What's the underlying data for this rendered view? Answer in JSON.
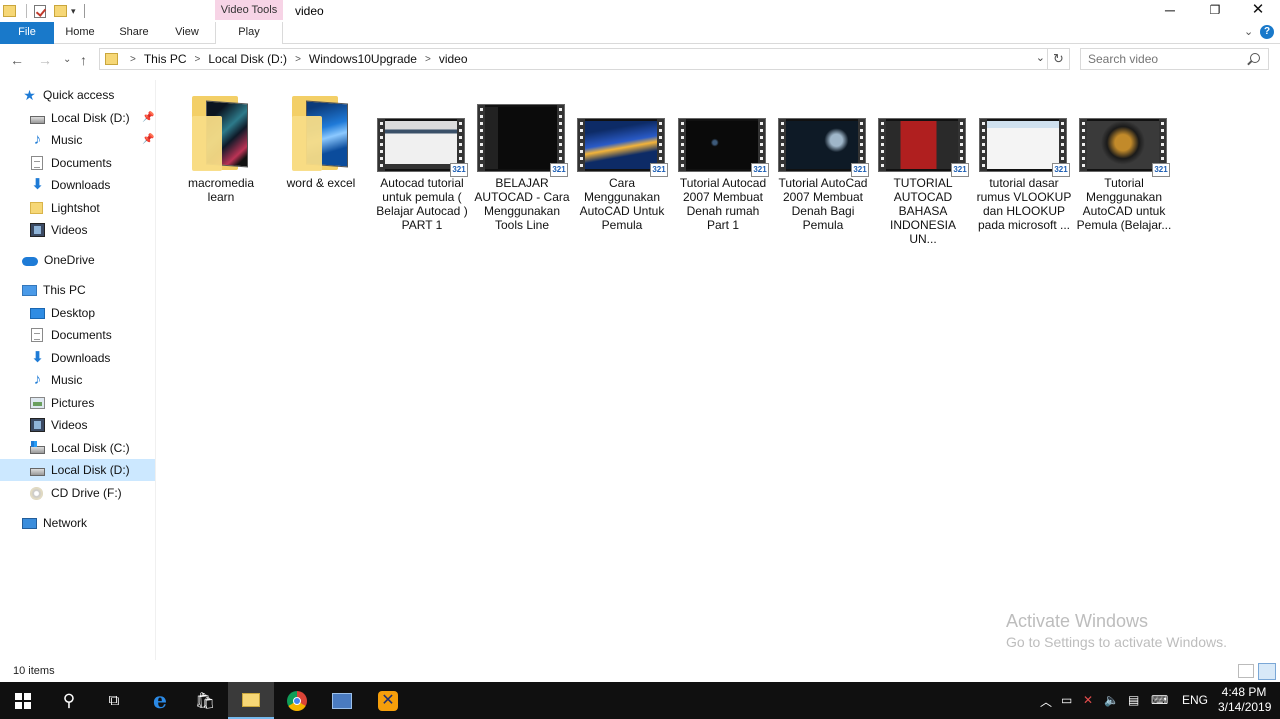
{
  "window": {
    "title": "video",
    "contextual_tab": "Video Tools"
  },
  "ribbon": {
    "tabs": [
      "File",
      "Home",
      "Share",
      "View",
      "Play"
    ]
  },
  "address": {
    "crumbs": [
      "This PC",
      "Local Disk (D:)",
      "Windows10Upgrade",
      "video"
    ]
  },
  "search": {
    "placeholder": "Search video"
  },
  "nav": {
    "quick_access": {
      "label": "Quick access",
      "items": [
        "Local Disk (D:)",
        "Music",
        "Documents",
        "Downloads",
        "Lightshot",
        "Videos"
      ]
    },
    "onedrive": "OneDrive",
    "this_pc": {
      "label": "This PC",
      "items": [
        "Desktop",
        "Documents",
        "Downloads",
        "Music",
        "Pictures",
        "Videos",
        "Local Disk (C:)",
        "Local Disk (D:)",
        "CD Drive (F:)"
      ]
    },
    "network": "Network",
    "selected": "Local Disk (D:)"
  },
  "files": [
    {
      "name": "macromedia learn",
      "kind": "folder"
    },
    {
      "name": "word & excel",
      "kind": "folder"
    },
    {
      "name": "Autocad tutorial untuk pemula ( Belajar Autocad ) PART 1",
      "kind": "video"
    },
    {
      "name": "BELAJAR AUTOCAD - Cara Menggunakan Tools Line",
      "kind": "video"
    },
    {
      "name": "Cara Menggunakan AutoCAD Untuk Pemula",
      "kind": "video"
    },
    {
      "name": "Tutorial Autocad 2007  Membuat Denah rumah Part 1",
      "kind": "video"
    },
    {
      "name": "Tutorial AutoCad 2007 Membuat Denah Bagi Pemula",
      "kind": "video"
    },
    {
      "name": "TUTORIAL AUTOCAD BAHASA INDONESIA UN...",
      "kind": "video"
    },
    {
      "name": "tutorial dasar rumus VLOOKUP dan HLOOKUP pada microsoft ...",
      "kind": "video"
    },
    {
      "name": "Tutorial Menggunakan AutoCAD untuk Pemula (Belajar...",
      "kind": "video"
    }
  ],
  "status": {
    "item_count": "10 items"
  },
  "watermark": {
    "line1": "Activate Windows",
    "line2": "Go to Settings to activate Windows."
  },
  "taskbar": {
    "language": "ENG",
    "time": "4:48 PM",
    "date": "3/14/2019",
    "accent": "#76b9ed"
  },
  "colors": {
    "file_tab": "#1979ca",
    "selection": "#cce8ff",
    "contextual_tab": "#f7d4e6"
  }
}
